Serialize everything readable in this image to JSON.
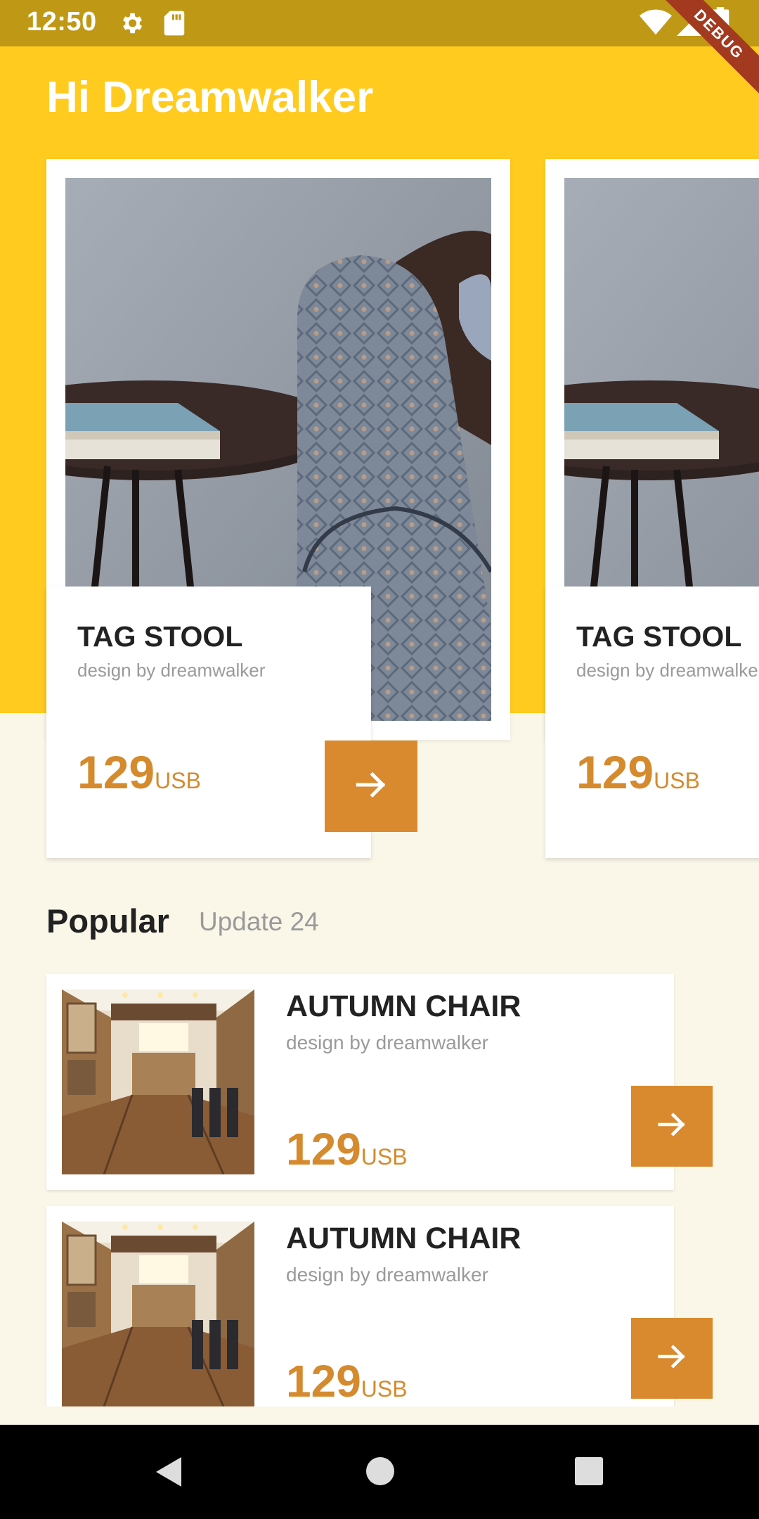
{
  "status_bar": {
    "time": "12:50",
    "icons": [
      "settings-icon",
      "sd-card-icon",
      "wifi-icon",
      "signal-icon",
      "battery-icon"
    ],
    "debug_label": "DEBUG"
  },
  "header": {
    "greeting": "Hi Dreamwalker"
  },
  "featured": [
    {
      "title": "TAG STOOL",
      "subtitle": "design by dreamwalker",
      "price": "129",
      "currency": "USB"
    },
    {
      "title": "TAG STOOL",
      "subtitle": "design by dreamwalker",
      "price": "129",
      "currency": "USB"
    }
  ],
  "popular": {
    "title": "Popular",
    "update": "Update 24",
    "items": [
      {
        "title": "AUTUMN CHAIR",
        "subtitle": "design by dreamwalker",
        "price": "129",
        "currency": "USB"
      },
      {
        "title": "AUTUMN CHAIR",
        "subtitle": "design by dreamwalker",
        "price": "129",
        "currency": "USB"
      }
    ]
  },
  "nav": {
    "buttons": [
      "back-icon",
      "home-icon",
      "recents-icon"
    ]
  },
  "colors": {
    "status_bar": "#BF9816",
    "header_yellow": "#FFCB1F",
    "page_bg": "#FAF7E9",
    "accent_orange": "#D98A2E",
    "price_orange": "#D58A2D",
    "debug_banner": "#A33A1F"
  }
}
